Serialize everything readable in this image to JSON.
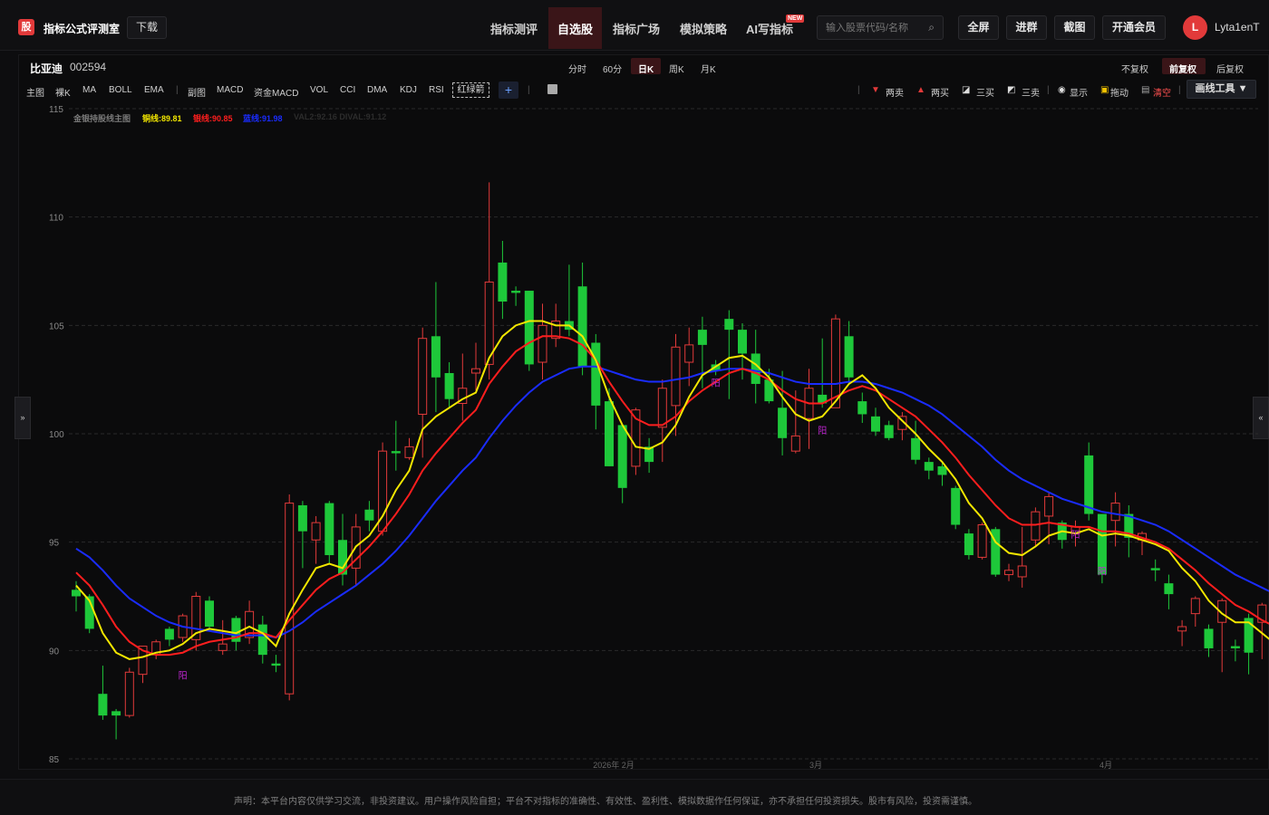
{
  "brand": {
    "logo_char": "股",
    "name": "指标公式评测室",
    "download": "下载"
  },
  "nav": {
    "items": [
      "指标测评",
      "自选股",
      "指标广场",
      "模拟策略",
      "AI写指标"
    ],
    "new_badge": "NEW"
  },
  "search": {
    "placeholder": "输入股票代码/名称"
  },
  "header_buttons": {
    "fullscreen": "全屏",
    "group": "进群",
    "screenshot": "截图",
    "member": "开通会员"
  },
  "user": {
    "initial": "L",
    "name": "Lyta1enT"
  },
  "stock": {
    "name": "比亚迪",
    "code": "002594"
  },
  "periods": [
    "分时",
    "60分",
    "日K",
    "周K",
    "月K"
  ],
  "adjust": [
    "不复权",
    "前复权",
    "后复权"
  ],
  "indicators": [
    "主图",
    "裸K",
    "MA",
    "BOLL",
    "EMA",
    "副图",
    "MACD",
    "资金MACD",
    "VOL",
    "CCI",
    "DMA",
    "KDJ",
    "RSI",
    "红绿箭"
  ],
  "tools": {
    "two_sell": "两卖",
    "two_buy": "两买",
    "three_buy": "三买",
    "three_sell": "三卖",
    "show": "显示",
    "drag": "拖动",
    "clear": "清空",
    "draw": "画线工具 ▼"
  },
  "legend": {
    "title": "金银持股线主图",
    "gold": "铜线:89.81",
    "silver": "银线:90.85",
    "blue": "蓝线:91.98",
    "dim": "VAL2:92.16  DIVAL:91.12"
  },
  "side_tabs": {
    "left": "»",
    "right": "«"
  },
  "footer": "声明：本平台内容仅供学习交流，非投资建议。用户操作风险自担；平台不对指标的准确性、有效性、盈利性、模拟数据作任何保证，亦不承担任何投资损失。股市有风险，投资需谨慎。",
  "colors": {
    "up": "#e23a3a",
    "down": "#1ec83a",
    "yellow": "#f2e600",
    "red": "#ff1e1e",
    "blue": "#1a2cff",
    "accent": "#e23a3a"
  },
  "chart_data": {
    "type": "candlestick",
    "y_ticks": [
      115,
      110,
      105,
      100,
      95,
      90,
      85
    ],
    "ylim": [
      85,
      115
    ],
    "x_ticks": [
      "2026年 2月",
      "3月",
      "4月"
    ],
    "markers": [
      "阳",
      "阳",
      "阳",
      "阳",
      "阳"
    ],
    "candles": [
      [
        92.8,
        92.5,
        93.2,
        91.8
      ],
      [
        92.5,
        91.0,
        92.6,
        90.8
      ],
      [
        88.0,
        87.0,
        89.3,
        86.8
      ],
      [
        87.2,
        87.0,
        87.3,
        85.9
      ],
      [
        87.0,
        89.0,
        89.2,
        86.9
      ],
      [
        88.9,
        90.2,
        90.2,
        88.5
      ],
      [
        89.8,
        90.4,
        90.5,
        89.6
      ],
      [
        91.0,
        90.5,
        91.1,
        90.2
      ],
      [
        90.6,
        91.6,
        91.7,
        90.4
      ],
      [
        90.5,
        92.5,
        92.7,
        90.0
      ],
      [
        92.3,
        91.1,
        92.5,
        90.9
      ],
      [
        90.0,
        90.3,
        91.4,
        89.8
      ],
      [
        91.5,
        90.4,
        91.6,
        90.0
      ],
      [
        90.6,
        91.8,
        92.3,
        90.3
      ],
      [
        91.2,
        89.8,
        91.6,
        89.4
      ],
      [
        89.4,
        89.3,
        89.8,
        89.0
      ],
      [
        88.0,
        96.8,
        97.2,
        87.7
      ],
      [
        96.7,
        95.5,
        96.9,
        93.8
      ],
      [
        95.1,
        95.9,
        96.2,
        94.0
      ],
      [
        96.8,
        94.4,
        96.9,
        94.0
      ],
      [
        95.1,
        93.5,
        96.3,
        93.0
      ],
      [
        93.8,
        95.7,
        96.3,
        93.0
      ],
      [
        96.5,
        96.0,
        96.9,
        95.5
      ],
      [
        95.5,
        99.2,
        99.6,
        95.3
      ],
      [
        99.2,
        99.1,
        100.6,
        98.3
      ],
      [
        98.9,
        99.4,
        99.8,
        98.8
      ],
      [
        100.9,
        104.4,
        104.9,
        98.9
      ],
      [
        104.5,
        102.6,
        107.0,
        101.0
      ],
      [
        102.8,
        101.6,
        103.3,
        101.2
      ],
      [
        101.4,
        102.1,
        103.7,
        100.6
      ],
      [
        102.8,
        103.0,
        104.2,
        102.0
      ],
      [
        103.2,
        107.0,
        111.6,
        102.5
      ],
      [
        107.9,
        106.1,
        108.9,
        105.3
      ],
      [
        106.6,
        106.5,
        106.8,
        105.9
      ],
      [
        106.6,
        103.2,
        106.6,
        102.9
      ],
      [
        103.3,
        105.0,
        106.0,
        102.5
      ],
      [
        104.4,
        105.2,
        106.0,
        104.0
      ],
      [
        105.2,
        104.8,
        107.8,
        104.5
      ],
      [
        106.8,
        103.1,
        107.9,
        102.7
      ],
      [
        104.2,
        101.3,
        104.6,
        100.2
      ],
      [
        101.5,
        98.5,
        102.1,
        98.5
      ],
      [
        100.4,
        97.5,
        100.3,
        96.8
      ],
      [
        98.5,
        101.1,
        101.2,
        98.1
      ],
      [
        99.4,
        98.7,
        99.8,
        98.2
      ],
      [
        100.3,
        102.1,
        102.5,
        98.7
      ],
      [
        101.3,
        104.0,
        104.6,
        99.9
      ],
      [
        103.3,
        104.1,
        104.9,
        102.2
      ],
      [
        104.8,
        104.1,
        105.4,
        102.1
      ],
      [
        103.2,
        102.9,
        103.4,
        102.7
      ],
      [
        105.3,
        104.8,
        105.7,
        101.6
      ],
      [
        104.8,
        103.7,
        105.1,
        102.5
      ],
      [
        103.7,
        102.3,
        104.8,
        101.4
      ],
      [
        102.5,
        101.5,
        103.0,
        101.4
      ],
      [
        101.2,
        99.8,
        102.9,
        99.0
      ],
      [
        99.2,
        99.9,
        102.0,
        99.1
      ],
      [
        100.7,
        102.1,
        103.0,
        99.3
      ],
      [
        101.8,
        101.4,
        104.4,
        101.2
      ],
      [
        101.2,
        105.3,
        105.5,
        101.2
      ],
      [
        104.5,
        102.6,
        105.2,
        102.3
      ],
      [
        101.5,
        100.9,
        101.9,
        100.5
      ],
      [
        100.8,
        100.1,
        101.2,
        99.9
      ],
      [
        100.4,
        99.8,
        100.6,
        99.7
      ],
      [
        100.2,
        100.8,
        101.0,
        99.7
      ],
      [
        99.8,
        98.8,
        100.6,
        98.6
      ],
      [
        98.7,
        98.3,
        98.9,
        97.9
      ],
      [
        98.5,
        98.1,
        98.7,
        97.6
      ],
      [
        97.5,
        95.8,
        97.6,
        95.6
      ],
      [
        95.4,
        94.4,
        95.6,
        94.2
      ],
      [
        94.3,
        95.8,
        95.9,
        94.2
      ],
      [
        95.6,
        93.5,
        95.7,
        93.4
      ],
      [
        93.5,
        93.7,
        94.0,
        93.2
      ],
      [
        93.4,
        93.9,
        95.7,
        92.9
      ],
      [
        95.1,
        96.4,
        96.6,
        94.8
      ],
      [
        96.2,
        97.1,
        97.3,
        94.9
      ],
      [
        95.9,
        95.1,
        96.0,
        94.7
      ],
      [
        95.4,
        95.7,
        96.0,
        94.8
      ],
      [
        99.0,
        96.3,
        99.6,
        96.0
      ],
      [
        96.3,
        93.5,
        96.3,
        93.1
      ],
      [
        96.0,
        96.8,
        97.3,
        94.8
      ],
      [
        96.3,
        95.2,
        96.7,
        94.3
      ],
      [
        95.1,
        95.4,
        95.5,
        94.4
      ],
      [
        93.8,
        93.7,
        94.2,
        93.2
      ],
      [
        93.1,
        92.6,
        93.5,
        91.9
      ],
      [
        90.9,
        91.1,
        91.4,
        90.2
      ],
      [
        91.7,
        92.4,
        92.5,
        91.1
      ],
      [
        91.0,
        90.1,
        91.2,
        89.7
      ],
      [
        91.3,
        92.3,
        92.4,
        89.0
      ],
      [
        90.2,
        90.1,
        90.5,
        89.5
      ],
      [
        91.5,
        89.9,
        91.7,
        88.9
      ],
      [
        91.3,
        92.1,
        92.2,
        89.6
      ],
      [
        90.4,
        89.7,
        90.6,
        89.3
      ],
      [
        89.5,
        87.8,
        89.7,
        87.7
      ]
    ],
    "ma_yellow": [
      93.0,
      92.3,
      90.8,
      89.9,
      89.6,
      89.7,
      89.9,
      90.0,
      90.3,
      90.8,
      91.0,
      90.9,
      90.8,
      91.1,
      90.8,
      90.2,
      91.7,
      92.8,
      93.8,
      94.0,
      93.8,
      94.8,
      95.3,
      96.2,
      97.4,
      98.3,
      100.2,
      100.8,
      101.2,
      101.6,
      101.9,
      103.5,
      104.5,
      105.0,
      105.2,
      105.2,
      105.0,
      105.0,
      104.5,
      103.4,
      101.7,
      100.4,
      99.4,
      99.3,
      99.6,
      100.4,
      101.7,
      102.7,
      103.1,
      103.5,
      103.6,
      103.2,
      102.6,
      101.7,
      100.9,
      100.6,
      100.8,
      101.5,
      102.3,
      102.7,
      102.1,
      101.2,
      100.6,
      100.0,
      99.3,
      98.7,
      97.9,
      96.8,
      96.1,
      95.0,
      94.5,
      94.4,
      94.8,
      95.3,
      95.5,
      95.4,
      95.6,
      95.3,
      95.4,
      95.3,
      95.1,
      94.9,
      94.6,
      93.8,
      93.2,
      92.3,
      91.7,
      91.3,
      91.3,
      90.8,
      90.3,
      89.7
    ],
    "ma_red": [
      93.6,
      93.0,
      92.1,
      91.1,
      90.4,
      90.0,
      89.8,
      89.8,
      89.9,
      90.2,
      90.4,
      90.5,
      90.6,
      90.8,
      90.8,
      90.6,
      91.4,
      92.1,
      92.8,
      93.3,
      93.6,
      94.2,
      94.8,
      95.5,
      96.3,
      97.2,
      98.3,
      99.1,
      99.8,
      100.5,
      101.1,
      102.3,
      103.1,
      103.8,
      104.2,
      104.5,
      104.5,
      104.4,
      104.1,
      103.4,
      102.4,
      101.5,
      100.7,
      100.4,
      100.4,
      100.8,
      101.5,
      102.0,
      102.4,
      102.8,
      103.0,
      102.8,
      102.5,
      102.0,
      101.6,
      101.4,
      101.4,
      101.7,
      102.0,
      102.2,
      102.0,
      101.6,
      101.2,
      100.8,
      100.2,
      99.6,
      98.9,
      98.1,
      97.4,
      96.7,
      96.1,
      95.8,
      95.8,
      95.9,
      95.8,
      95.7,
      95.7,
      95.5,
      95.5,
      95.4,
      95.2,
      95.0,
      94.7,
      94.2,
      93.7,
      93.1,
      92.6,
      92.1,
      91.8,
      91.4,
      91.1,
      90.5
    ],
    "ma_blue": [
      94.7,
      94.3,
      93.7,
      93.0,
      92.4,
      92.0,
      91.6,
      91.3,
      91.1,
      91.0,
      90.9,
      90.8,
      90.7,
      90.7,
      90.7,
      90.6,
      90.9,
      91.3,
      91.8,
      92.2,
      92.6,
      93.0,
      93.5,
      94.0,
      94.6,
      95.3,
      96.1,
      96.9,
      97.6,
      98.3,
      98.9,
      99.8,
      100.6,
      101.3,
      101.9,
      102.4,
      102.7,
      103.0,
      103.1,
      103.1,
      102.9,
      102.7,
      102.5,
      102.4,
      102.4,
      102.5,
      102.6,
      102.8,
      102.9,
      103.0,
      103.0,
      102.9,
      102.8,
      102.6,
      102.4,
      102.3,
      102.3,
      102.3,
      102.4,
      102.4,
      102.3,
      102.1,
      101.9,
      101.6,
      101.3,
      100.9,
      100.4,
      99.9,
      99.4,
      98.8,
      98.3,
      97.9,
      97.6,
      97.3,
      97.0,
      96.8,
      96.6,
      96.4,
      96.3,
      96.2,
      96.0,
      95.8,
      95.5,
      95.1,
      94.7,
      94.3,
      93.9,
      93.5,
      93.2,
      92.9,
      92.6,
      92.1
    ]
  }
}
